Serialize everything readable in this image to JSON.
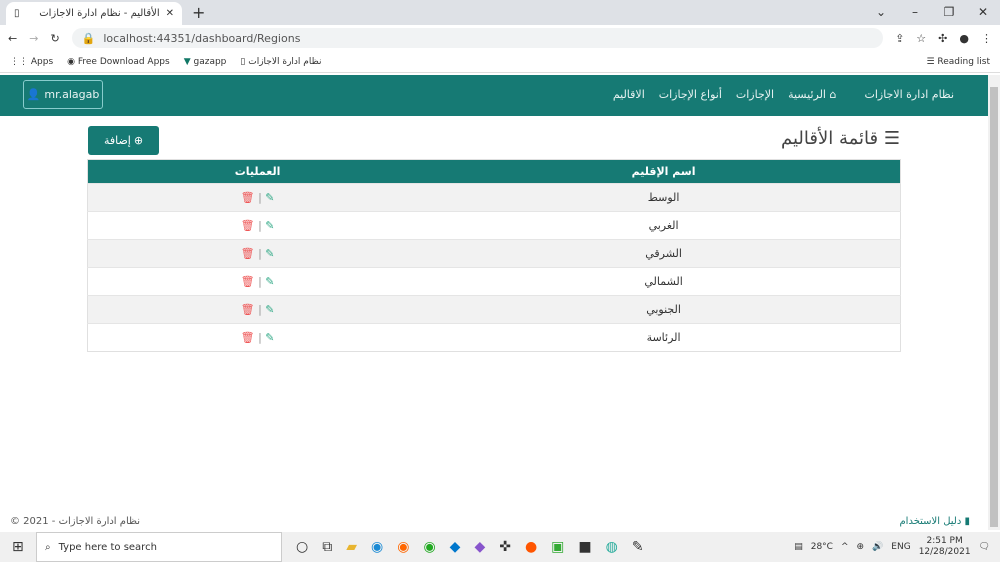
{
  "browser": {
    "tab_title": "الأقاليم - نظام ادارة الاجازات",
    "url": "localhost:44351/dashboard/Regions",
    "bookmarks": [
      "Apps",
      "Free Download Apps",
      "gazapp",
      "نظام ادارة الاجازات"
    ],
    "reading_list": "Reading list"
  },
  "nav": {
    "user": "mr.alagab",
    "brand": "نظام ادارة الاجازات",
    "items": [
      "الرئيسية",
      "الإجازات",
      "أنواع الإجازات",
      "الاقاليم"
    ]
  },
  "page": {
    "title": "قائمة الأقاليم",
    "add_label": "إضافة",
    "columns": [
      "اسم الإقليم",
      "العمليات"
    ],
    "rows": [
      "الوسط",
      "الغربي",
      "الشرقي",
      "الشمالي",
      "الجنوبي",
      "الرئاسة"
    ]
  },
  "footer": {
    "copyright": "© 2021 - نظام ادارة الاجازات",
    "guide": "دليل الاستخدام"
  },
  "taskbar": {
    "search_placeholder": "Type here to search",
    "temp": "28°C",
    "lang": "ENG",
    "time": "2:51 PM",
    "date": "12/28/2021"
  }
}
